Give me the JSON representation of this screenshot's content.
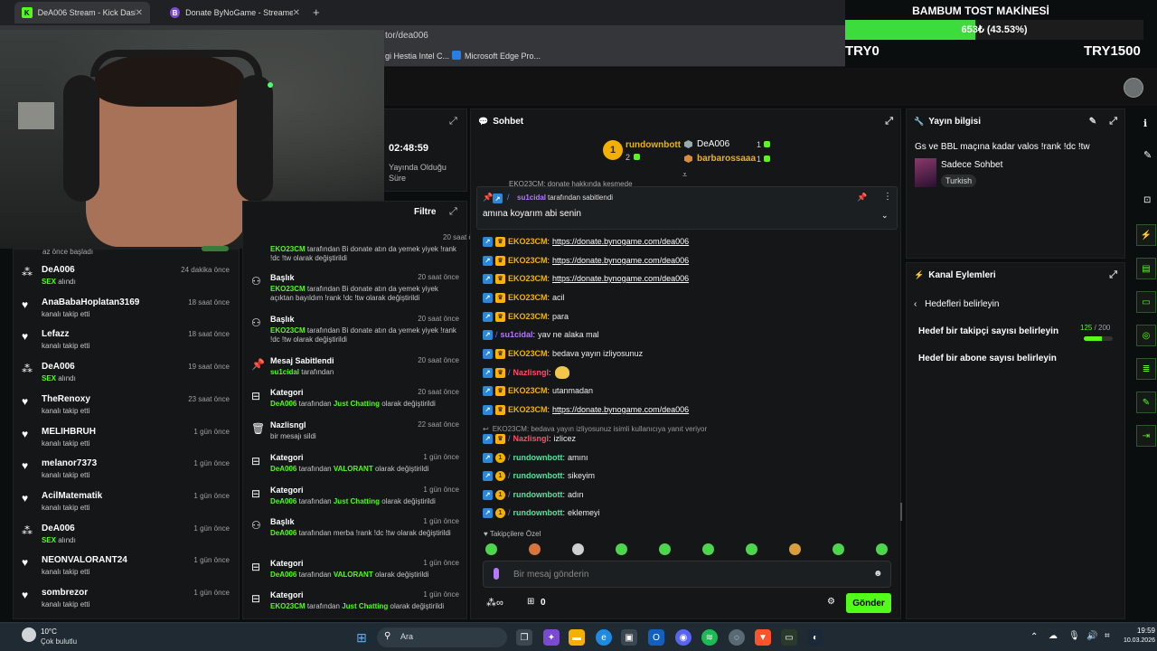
{
  "browser": {
    "tabs": [
      {
        "title": "DeA006 Stream - Kick Dashboard"
      },
      {
        "title": "Donate ByNoGame - Streamer Settings"
      }
    ],
    "url_fragment": "tor/dea006",
    "bookmarks": [
      "gi Hestia Intel C...",
      "Microsoft Edge Pro..."
    ]
  },
  "donation_overlay": {
    "title": "BAMBUM TOST MAKİNESİ",
    "progress_text": "653₺ (43.53%)",
    "progress_value": 43.53,
    "min_label": "TRY0",
    "max_label": "TRY1500"
  },
  "stream_info_left": {
    "duration": "02:48:59",
    "duration_label": "Yayında Olduğu Süre",
    "filter_label": "Filtre"
  },
  "activity_feed": {
    "top_partial": "az önce başladı",
    "items": [
      {
        "name": "DeA006",
        "sub": "SEX alındı",
        "time": "24 dakika önce",
        "icon": "star-icon",
        "sub_green": true
      },
      {
        "name": "AnaBabaHoplatan3169",
        "sub": "kanalı takip etti",
        "time": "18 saat önce",
        "icon": "heart-icon"
      },
      {
        "name": "Lefazz",
        "sub": "kanalı takip etti",
        "time": "18 saat önce",
        "icon": "heart-icon"
      },
      {
        "name": "DeA006",
        "sub": "SEX alındı",
        "time": "19 saat önce",
        "icon": "star-icon",
        "sub_green": true
      },
      {
        "name": "TheRenoxy",
        "sub": "kanalı takip etti",
        "time": "23 saat önce",
        "icon": "heart-icon"
      },
      {
        "name": "MELIHBRUH",
        "sub": "kanalı takip etti",
        "time": "1 gün önce",
        "icon": "heart-icon"
      },
      {
        "name": "melanor7373",
        "sub": "kanalı takip etti",
        "time": "1 gün önce",
        "icon": "heart-icon"
      },
      {
        "name": "AcilMatematik",
        "sub": "kanalı takip etti",
        "time": "1 gün önce",
        "icon": "heart-icon"
      },
      {
        "name": "DeA006",
        "sub": "SEX alındı",
        "time": "1 gün önce",
        "icon": "star-icon",
        "sub_green": true
      },
      {
        "name": "NEONVALORANT24",
        "sub": "kanalı takip etti",
        "time": "1 gün önce",
        "icon": "heart-icon"
      },
      {
        "name": "sombrezor",
        "sub": "kanalı takip etti",
        "time": "1 gün önce",
        "icon": "heart-icon"
      }
    ]
  },
  "moderation_log": {
    "top_partial": {
      "user": "EKO23CM",
      "text": "tarafından Bi donate atın da yemek yiyek !rank !dc !tw olarak değiştirildi",
      "time": "20 saat önce"
    },
    "items": [
      {
        "title": "Başlık",
        "user": "EKO23CM",
        "rest": "tarafından Bi donate atın da yemek yiyek açıktan bayıldım !rank !dc !tw olarak değiştirildi",
        "time": "20 saat önce",
        "icon": "users-icon"
      },
      {
        "title": "Başlık",
        "user": "EKO23CM",
        "rest": "tarafından Bi donate atın da yemek yiyek !rank !dc !tw olarak değiştirildi",
        "time": "20 saat önce",
        "icon": "users-icon"
      },
      {
        "title": "Mesaj Sabitlendi",
        "user": "su1cidal",
        "rest": "tarafından",
        "time": "20 saat önce",
        "icon": "pin-icon"
      },
      {
        "title": "Kategori",
        "user": "DeA006",
        "rest_pre": "tarafından",
        "highlight": "Just Chatting",
        "rest": "olarak değiştirildi",
        "time": "20 saat önce",
        "icon": "category-icon"
      },
      {
        "title": "Nazlisngl",
        "plain": "bir mesajı sildi",
        "time": "22 saat önce",
        "icon": "trash-icon"
      },
      {
        "title": "Kategori",
        "user": "DeA006",
        "rest_pre": "tarafından",
        "highlight": "VALORANT",
        "rest": "olarak değiştirildi",
        "time": "1 gün önce",
        "icon": "category-icon"
      },
      {
        "title": "Kategori",
        "user": "DeA006",
        "rest_pre": "tarafından",
        "highlight": "Just Chatting",
        "rest": "olarak değiştirildi",
        "time": "1 gün önce",
        "icon": "category-icon"
      },
      {
        "title": "Başlık",
        "user": "DeA006",
        "rest": "tarafından merba !rank !dc !tw olarak değiştirildi",
        "time": "1 gün önce",
        "icon": "users-icon"
      },
      {
        "title": "Kategori",
        "user": "DeA006",
        "rest_pre": "tarafından",
        "highlight": "VALORANT",
        "rest": "olarak değiştirildi",
        "time": "1 gün önce",
        "icon": "category-icon"
      },
      {
        "title": "Kategori",
        "user": "EKO23CM",
        "rest_pre": "tarafından",
        "highlight": "Just Chatting",
        "rest": "olarak değiştirildi",
        "time": "1 gün önce",
        "icon": "category-icon"
      }
    ]
  },
  "chat": {
    "title": "Sohbet",
    "leaderboard": [
      {
        "name": "rundownbott",
        "count": "2",
        "rank": "1"
      },
      {
        "name": "DeA006",
        "count": "1"
      },
      {
        "name": "barbarossaaa",
        "count": "1"
      }
    ],
    "top_partial": "EKO23CM: donate hakkında kesmede",
    "pinned": {
      "by_user": "su1cidal",
      "by_text": "tarafından sabitlendi",
      "message": "amına koyarım abi senin"
    },
    "messages": [
      {
        "user": "EKO23CM",
        "color": "gold",
        "badges": [
          "mod",
          "crown"
        ],
        "link": "https://donate.bynogame.com/dea006"
      },
      {
        "user": "EKO23CM",
        "color": "gold",
        "badges": [
          "mod",
          "crown"
        ],
        "link": "https://donate.bynogame.com/dea006"
      },
      {
        "user": "EKO23CM",
        "color": "gold",
        "badges": [
          "mod",
          "crown"
        ],
        "link": "https://donate.bynogame.com/dea006"
      },
      {
        "user": "EKO23CM",
        "color": "gold",
        "badges": [
          "mod",
          "crown"
        ],
        "text": "acil"
      },
      {
        "user": "EKO23CM",
        "color": "gold",
        "badges": [
          "mod",
          "crown"
        ],
        "text": "para"
      },
      {
        "user": "su1cidal",
        "color": "purple",
        "badges": [
          "mod",
          "tw"
        ],
        "text": "yav ne alaka mal"
      },
      {
        "user": "EKO23CM",
        "color": "gold",
        "badges": [
          "mod",
          "crown"
        ],
        "text": "bedava yayın izliyosunuz"
      },
      {
        "user": "Nazlisngl",
        "color": "red",
        "badges": [
          "mod",
          "crown",
          "tw"
        ],
        "emote": true
      },
      {
        "user": "EKO23CM",
        "color": "gold",
        "badges": [
          "mod",
          "crown"
        ],
        "text": "utanmadan"
      },
      {
        "user": "EKO23CM",
        "color": "gold",
        "badges": [
          "mod",
          "crown"
        ],
        "link": "https://donate.bynogame.com/dea006"
      },
      {
        "reply_to": "EKO23CM: bedava yayın izliyosunuz isimli kullanıcıya yanıt veriyor"
      },
      {
        "user": "Nazlisngl",
        "color": "red",
        "badges": [
          "mod",
          "crown",
          "tw"
        ],
        "text": "izlicez"
      },
      {
        "user": "rundownbott",
        "color": "green",
        "badges": [
          "mod",
          "one",
          "tw"
        ],
        "text": "amını"
      },
      {
        "user": "rundownbott",
        "color": "green",
        "badges": [
          "mod",
          "one",
          "tw"
        ],
        "text": "sikeyim"
      },
      {
        "user": "rundownbott",
        "color": "green",
        "badges": [
          "mod",
          "one",
          "tw"
        ],
        "text": "adın"
      },
      {
        "user": "rundownbott",
        "color": "green",
        "badges": [
          "mod",
          "one",
          "tw"
        ],
        "text": "eklemeyi"
      }
    ],
    "followers_only_label": "Takipçilere Özel",
    "input_placeholder": "Bir mesaj gönderin",
    "viewer_count": "0",
    "send_label": "Gönder"
  },
  "stream_info": {
    "title": "Yayın bilgisi",
    "stream_title": "Gs ve BBL maçına kadar valos !rank !dc !tw",
    "category": "Sadece Sohbet",
    "language": "Turkish"
  },
  "channel_actions": {
    "title": "Kanal Eylemleri",
    "back_label": "Hedefleri belirleyin",
    "follower_goal_label": "Hedef bir takipçi sayısı belirleyin",
    "follower_goal_current": "125",
    "follower_goal_target": "200",
    "follower_goal_progress": 62.5,
    "sub_goal_label": "Hedef bir abone sayısı belirleyin"
  },
  "taskbar": {
    "weather_temp": "10°C",
    "weather_text": "Çok bulutlu",
    "search_label": "Ara",
    "time": "19:59",
    "date": "10.03.2026"
  }
}
